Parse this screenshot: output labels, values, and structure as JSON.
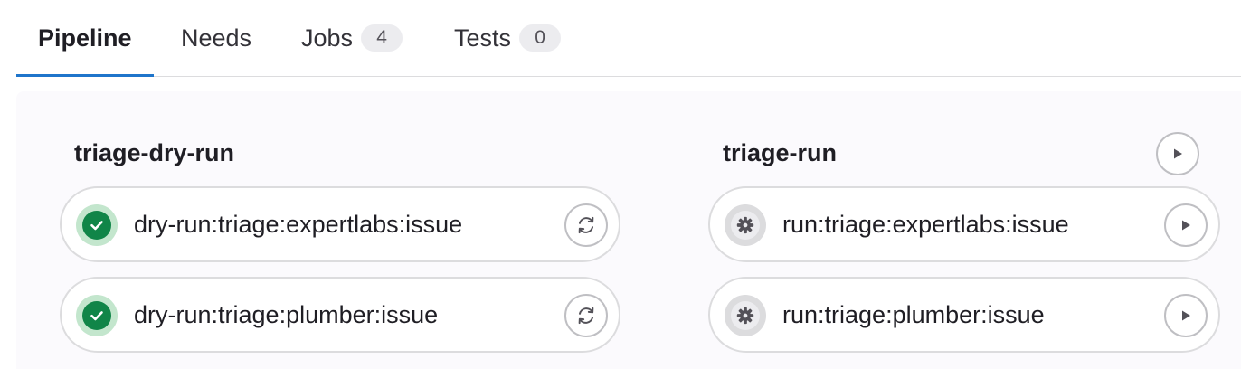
{
  "tabs": [
    {
      "label": "Pipeline",
      "active": true
    },
    {
      "label": "Needs"
    },
    {
      "label": "Jobs",
      "count": "4"
    },
    {
      "label": "Tests",
      "count": "0"
    }
  ],
  "stages": [
    {
      "title": "triage-dry-run",
      "jobs": [
        {
          "name": "dry-run:triage:expertlabs:issue",
          "status": "success",
          "action_icon": "retry-icon"
        },
        {
          "name": "dry-run:triage:plumber:issue",
          "status": "success",
          "action_icon": "retry-icon"
        }
      ]
    },
    {
      "title": "triage-run",
      "action_icon": "play-icon",
      "jobs": [
        {
          "name": "run:triage:expertlabs:issue",
          "status": "manual",
          "action_icon": "play-icon"
        },
        {
          "name": "run:triage:plumber:issue",
          "status": "manual",
          "action_icon": "play-icon"
        }
      ]
    }
  ],
  "colors": {
    "accent": "#1f75cb",
    "success": "#108548",
    "success_halo": "#c3e6cd",
    "manual": "#535158",
    "border": "#dcdcde",
    "graph_bg": "#fbfafd"
  }
}
